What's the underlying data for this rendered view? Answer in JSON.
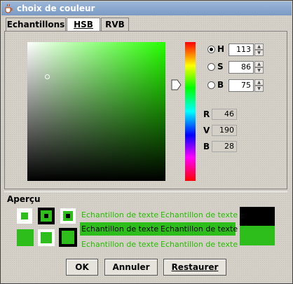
{
  "window": {
    "title": "choix de couleur"
  },
  "tabs": [
    {
      "label": "Echantillons",
      "active": false
    },
    {
      "label": "HSB",
      "active": true
    },
    {
      "label": "RVB",
      "active": false
    }
  ],
  "hsb": [
    {
      "label": "H",
      "value": "113",
      "selected": true
    },
    {
      "label": "S",
      "value": "86",
      "selected": false
    },
    {
      "label": "B",
      "value": "75",
      "selected": false
    }
  ],
  "rgb": [
    {
      "label": "R",
      "value": "46"
    },
    {
      "label": "V",
      "value": "190"
    },
    {
      "label": "B",
      "value": "28"
    }
  ],
  "preview": {
    "title": "Aperçu",
    "sample_text": "Echantillon de texte",
    "color": "#2ebe1c"
  },
  "buttons": {
    "ok": "OK",
    "cancel": "Annuler",
    "reset": "Restaurer"
  }
}
